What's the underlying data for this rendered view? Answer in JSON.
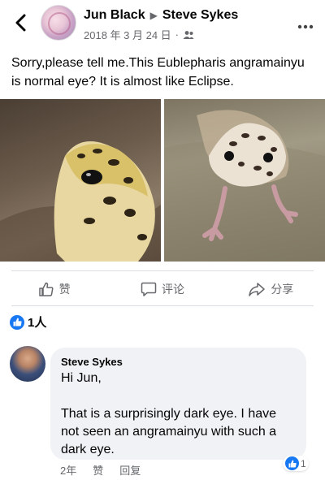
{
  "post": {
    "author": "Jun Black",
    "group": "Steve Sykes",
    "date": "2018 年 3 月 24 日",
    "separator": "·",
    "text": "Sorry,please tell me.This Eublepharis angramainyu is normal eye?  It is almost like Eclipse."
  },
  "actions": {
    "like": "赞",
    "comment": "评论",
    "share": "分享"
  },
  "reactions": {
    "count": "1人"
  },
  "comment": {
    "author": "Steve Sykes",
    "text": "Hi Jun,\n\nThat is a surprisingly dark eye.  I have not seen an angramainyu with such a dark eye.",
    "age": "2年",
    "like": "赞",
    "reply": "回复",
    "like_count": "1"
  },
  "icons": {
    "back": "back-arrow-icon",
    "more": "more-options-icon",
    "audience": "friends-audience-icon",
    "like": "thumbs-up-icon",
    "comment": "comment-bubble-icon",
    "share": "share-arrow-icon"
  },
  "colors": {
    "accent": "#1877f2",
    "secondary_text": "#65676b",
    "bubble": "#f0f2f5"
  }
}
